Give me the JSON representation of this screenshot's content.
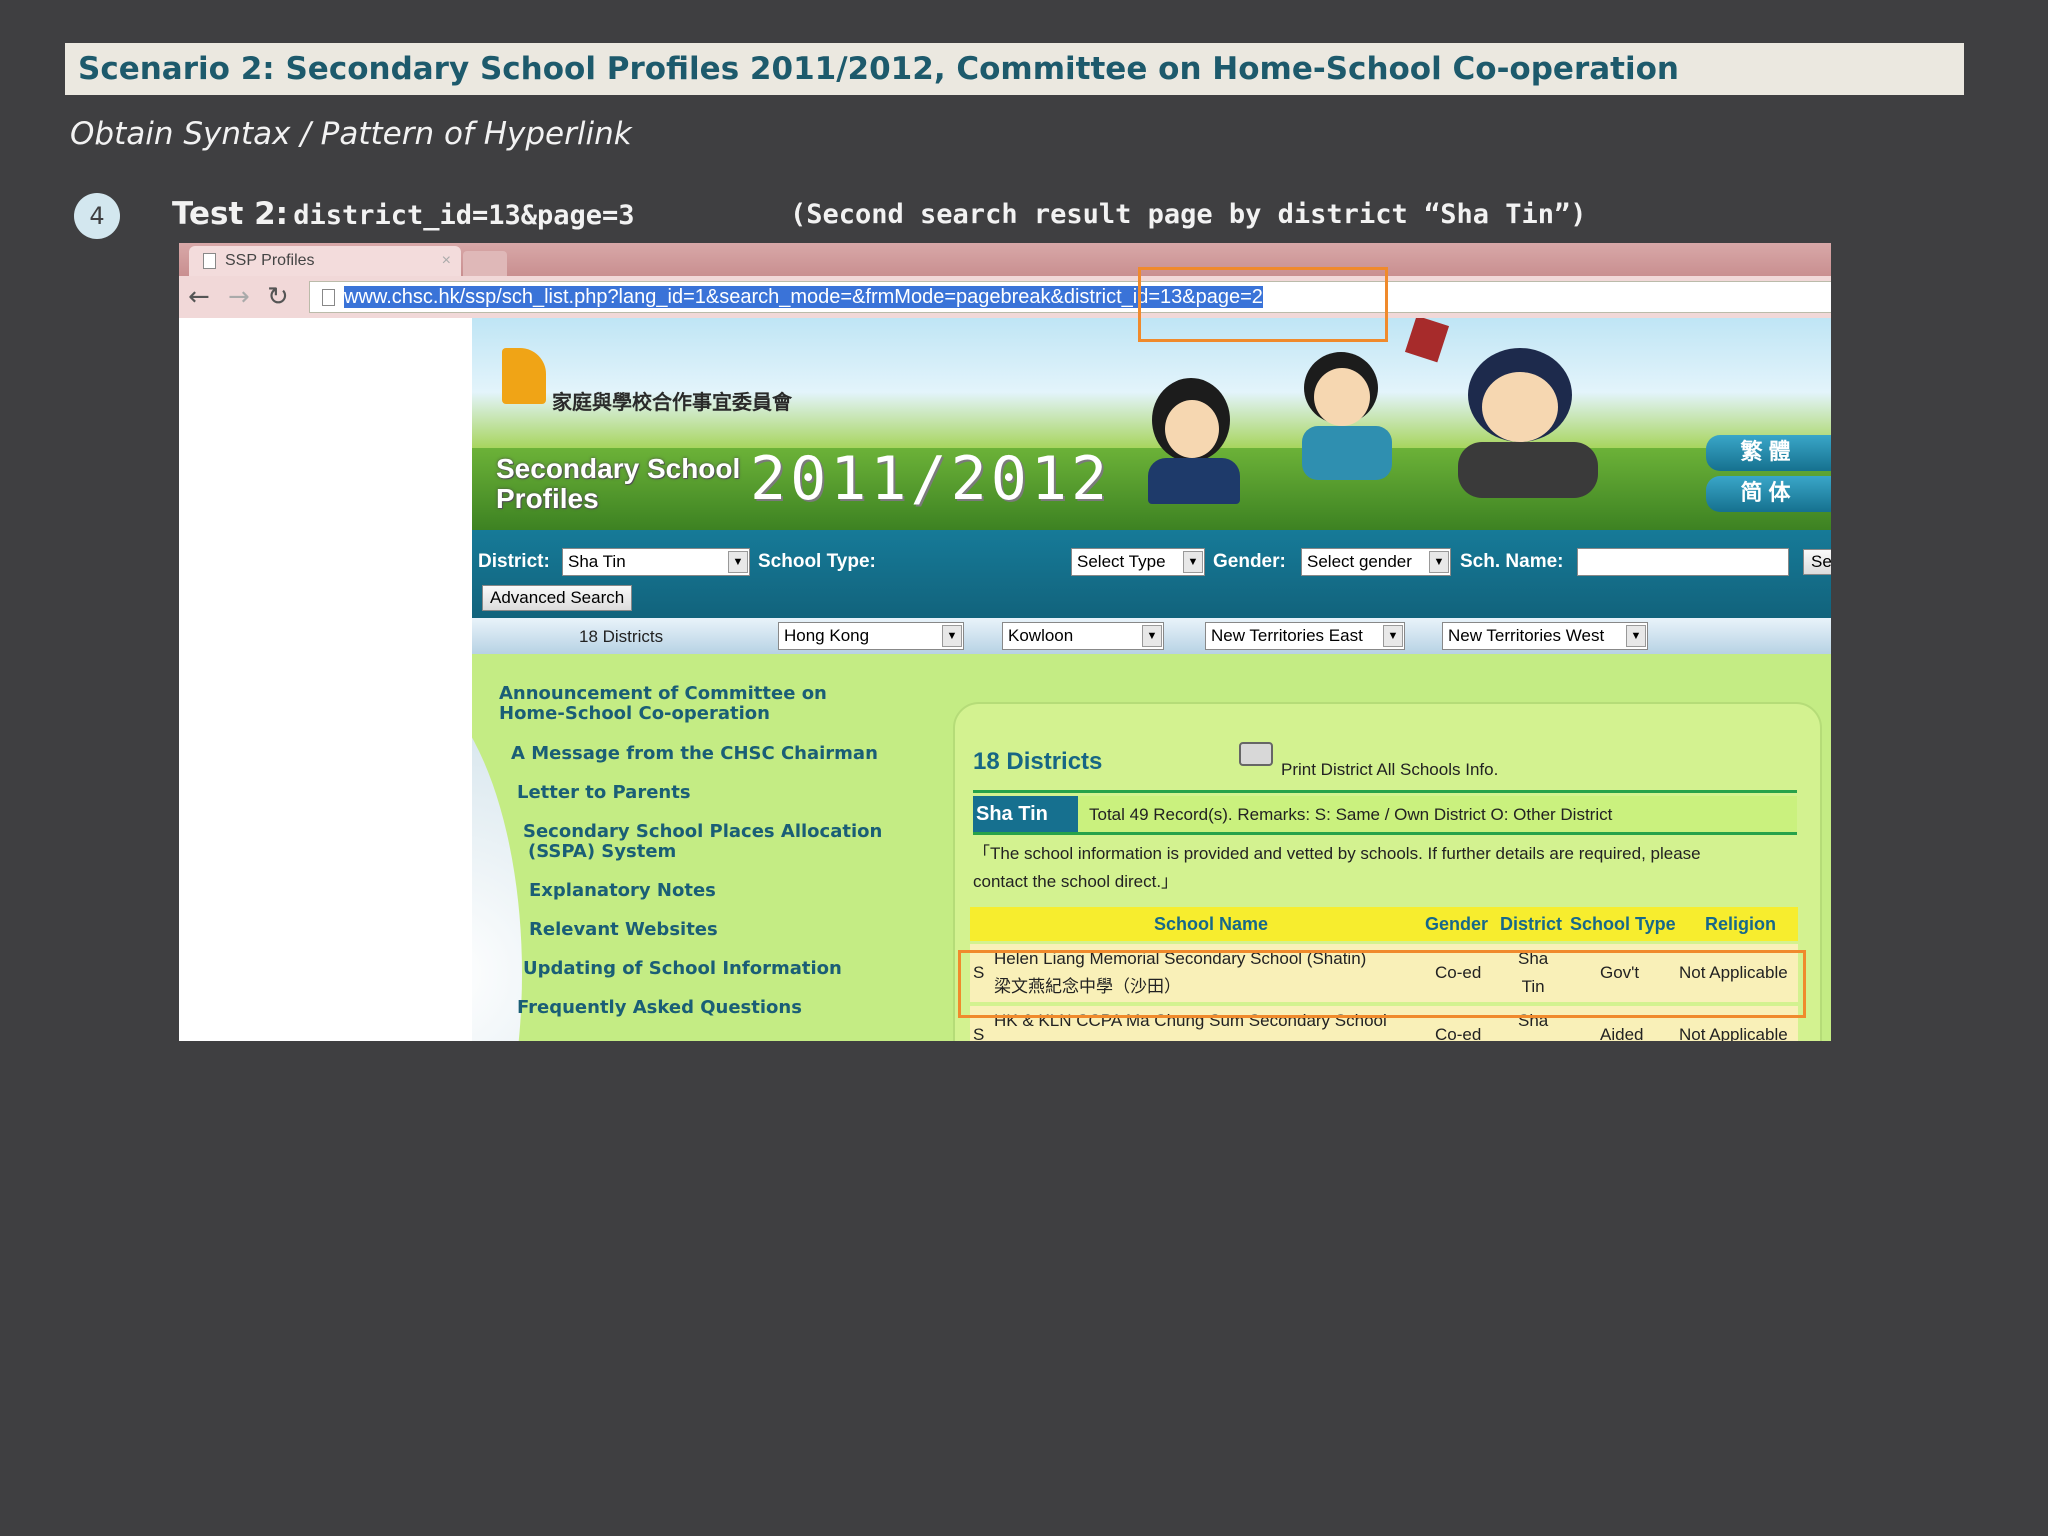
{
  "slide": {
    "title": "Scenario 2: Secondary School Profiles 2011/2012, Committee on Home-School Co-operation",
    "subtitle": "Obtain Syntax / Pattern of Hyperlink",
    "step": "4",
    "test_label": "Test 2:",
    "test_code": "district_id=13&page=3",
    "test_note": "(Second search result page by district “Sha Tin”)"
  },
  "browser": {
    "tab_title": "SSP Profiles",
    "tab_close": "×",
    "url": "www.chsc.hk/ssp/sch_list.php?lang_id=1&search_mode=&frmMode=pagebreak&district_id=13&page=2",
    "back": "←",
    "forward": "→",
    "reload": "↻"
  },
  "site": {
    "logo_text": "家庭與學校合作事宜委員會",
    "banner_title_1": "Secondary School",
    "banner_title_2": "Profiles",
    "banner_year": "2011/2012",
    "lang_trad": "繁體",
    "lang_simp": "简体",
    "search": {
      "district_label": "District:",
      "district_value": "Sha Tin",
      "type_label": "School Type:",
      "type_value": "Select Type",
      "gender_label": "Gender:",
      "gender_value": "Select gender",
      "name_label": "Sch. Name:",
      "search_button": "Search",
      "advanced_button": "Advanced Search"
    },
    "districts": {
      "label": "18 Districts",
      "hong_kong": "Hong Kong",
      "kowloon": "Kowloon",
      "nt_east": "New Territories East",
      "nt_west": "New Territories West"
    },
    "sidebar": [
      "Announcement of Committee on",
      "Home-School Co-operation",
      "A Message from the CHSC Chairman",
      "Letter to Parents",
      "Secondary School Places Allocation",
      "(SSPA) System",
      "Explanatory Notes",
      "Relevant Websites",
      "Updating of School Information",
      "Frequently Asked Questions"
    ],
    "panel": {
      "heading": "18 Districts",
      "print_link": "Print District All Schools Info.",
      "district_chip": "Sha Tin",
      "records": "Total 49 Record(s).   Remarks: S: Same / Own District    O: Other District",
      "notice_1": "「The school information is provided and vetted by schools. If further details are required, please",
      "notice_2": "contact the school direct.」",
      "headers": {
        "name": "School Name",
        "gender": "Gender",
        "district": "District",
        "type": "School Type",
        "religion": "Religion"
      },
      "rows": [
        {
          "mark": "S",
          "name_en": "Helen Liang Memorial Secondary School (Shatin)",
          "name_zh": "梁文燕紀念中學（沙田）",
          "gender": "Co-ed",
          "district_1": "Sha",
          "district_2": "Tin",
          "type": "Gov't",
          "religion": "Not Applicable"
        },
        {
          "mark": "S",
          "name_en": "HK & KLN CCPA Ma Chung Sum Secondary School",
          "gender": "Co-ed",
          "district_1": "Sha",
          "type": "Aided",
          "religion": "Not Applicable"
        }
      ]
    }
  }
}
